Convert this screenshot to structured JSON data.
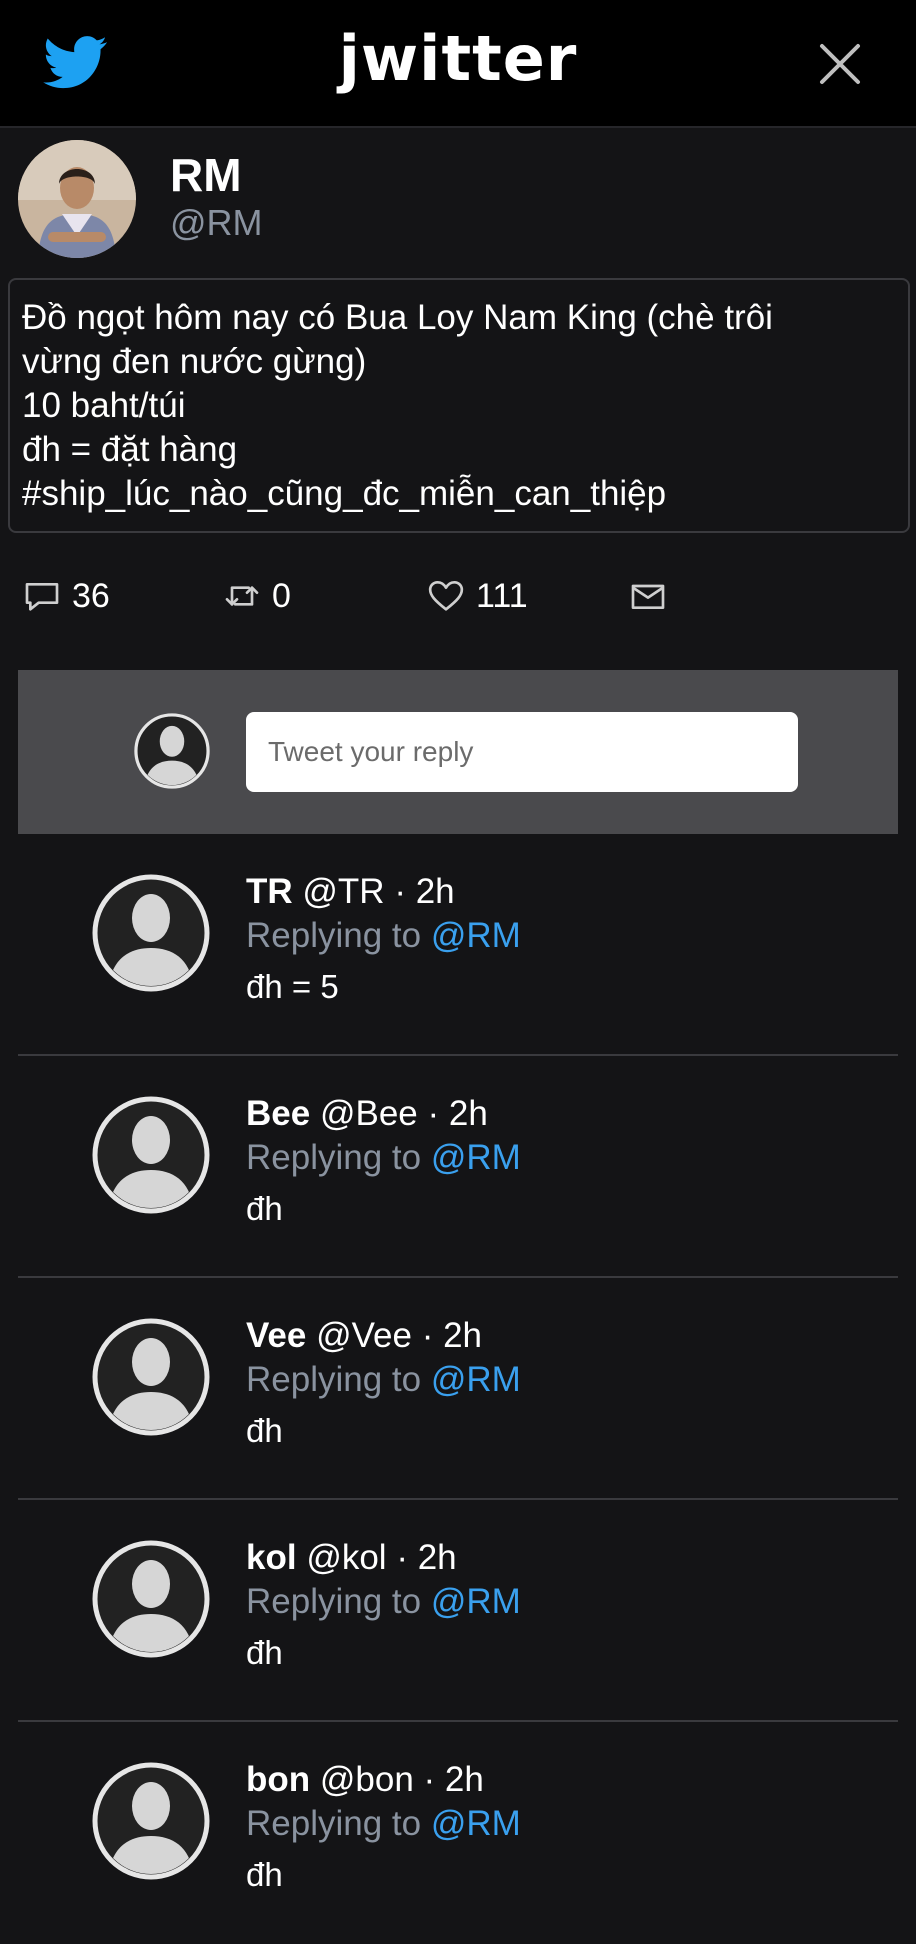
{
  "header": {
    "brand": "jwitter",
    "brand_color": "#1da1f2"
  },
  "author": {
    "name": "RM",
    "handle": "@RM"
  },
  "tweet": {
    "lines": [
      "Đồ ngọt hôm nay có Bua Loy Nam King (chè trôi",
      "vừng đen nước gừng)",
      "10 baht/túi",
      "đh = đặt hàng",
      "#ship_lúc_nào_cũng_đc_miễn_can_thiệp"
    ]
  },
  "actions": {
    "replies": "36",
    "retweets": "0",
    "likes": "111"
  },
  "reply_box": {
    "placeholder": "Tweet your reply"
  },
  "replies": [
    {
      "name": "TR",
      "handle": "@TR",
      "time": "· 2h",
      "replying": "Replying to",
      "mention": "@RM",
      "text": "đh = 5"
    },
    {
      "name": "Bee",
      "handle": "@Bee",
      "time": "· 2h",
      "replying": "Replying to",
      "mention": "@RM",
      "text": "đh"
    },
    {
      "name": "Vee",
      "handle": "@Vee",
      "time": "· 2h",
      "replying": "Replying to",
      "mention": "@RM",
      "text": "đh"
    },
    {
      "name": "kol",
      "handle": "@kol",
      "time": "· 2h",
      "replying": "Replying to",
      "mention": "@RM",
      "text": "đh"
    },
    {
      "name": "bon",
      "handle": "@bon",
      "time": "· 2h",
      "replying": "Replying to",
      "mention": "@RM",
      "text": "đh"
    }
  ]
}
